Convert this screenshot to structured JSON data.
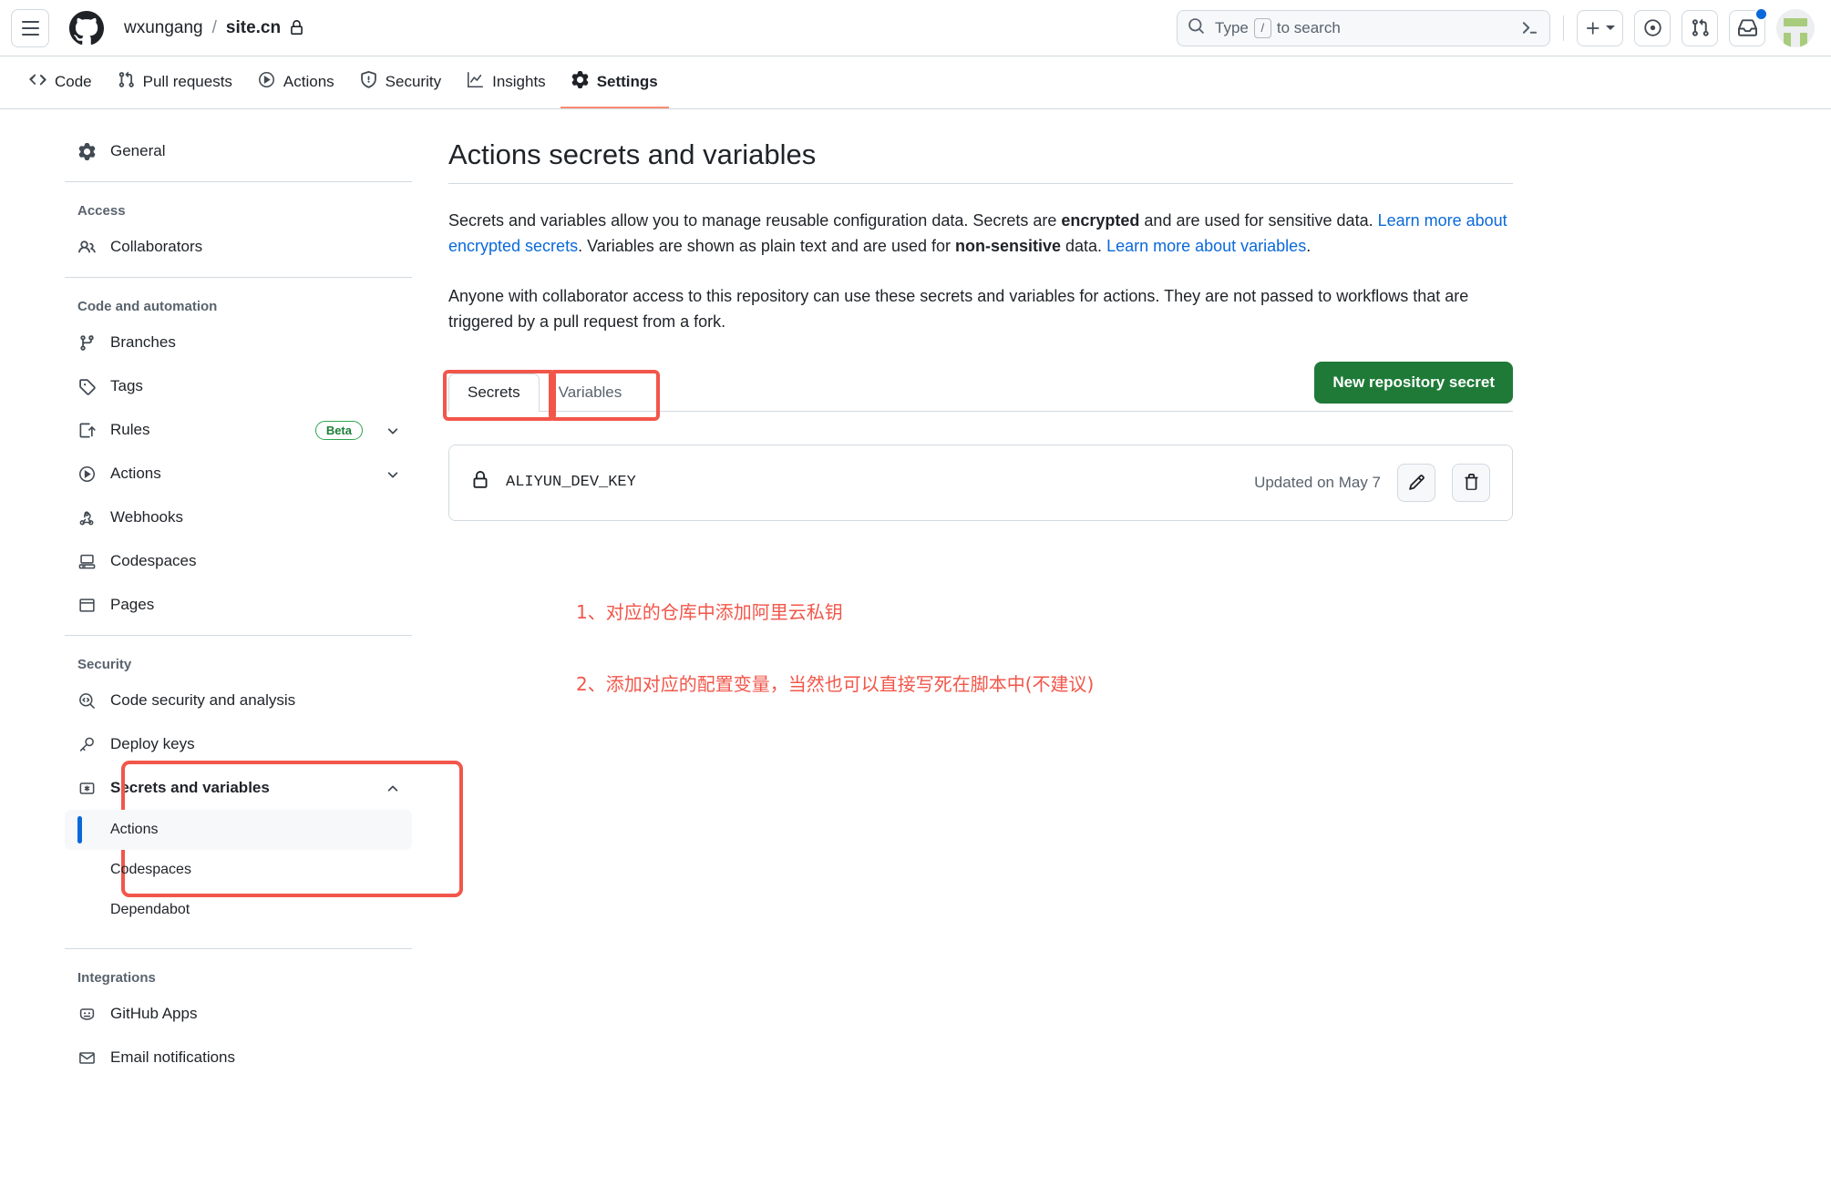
{
  "header": {
    "menu_icon": "hamburger-icon",
    "logo_icon": "github-logo-icon",
    "owner": "wxungang",
    "separator": "/",
    "repo": "site.cn",
    "private_lock_icon": "lock-icon",
    "search": {
      "icon": "search-icon",
      "placeholder_prefix": "Type",
      "slash_key": "/",
      "placeholder_suffix": "to search",
      "terminal_icon": "terminal-icon"
    },
    "create_new_label": "+",
    "issues_icon": "issue-opened-icon",
    "pull_requests_icon": "git-pull-request-icon",
    "inbox_icon": "inbox-icon",
    "avatar_label": "avatar",
    "has_notification": true
  },
  "repo_nav": [
    {
      "label": "Code",
      "icon": "code-icon",
      "active": false
    },
    {
      "label": "Pull requests",
      "icon": "git-pull-request-icon",
      "active": false
    },
    {
      "label": "Actions",
      "icon": "play-icon",
      "active": false
    },
    {
      "label": "Security",
      "icon": "shield-icon",
      "active": false
    },
    {
      "label": "Insights",
      "icon": "graph-icon",
      "active": false
    },
    {
      "label": "Settings",
      "icon": "gear-icon",
      "active": true
    }
  ],
  "sidebar": {
    "general": {
      "label": "General",
      "icon": "gear-icon"
    },
    "sections": [
      {
        "heading": "Access",
        "items": [
          {
            "label": "Collaborators",
            "icon": "people-icon"
          }
        ]
      },
      {
        "heading": "Code and automation",
        "items": [
          {
            "label": "Branches",
            "icon": "git-branch-icon"
          },
          {
            "label": "Tags",
            "icon": "tag-icon"
          },
          {
            "label": "Rules",
            "icon": "rules-icon",
            "badge": "Beta",
            "chevron": "chevron-down-icon"
          },
          {
            "label": "Actions",
            "icon": "play-icon",
            "chevron": "chevron-down-icon"
          },
          {
            "label": "Webhooks",
            "icon": "webhook-icon"
          },
          {
            "label": "Codespaces",
            "icon": "codespaces-icon"
          },
          {
            "label": "Pages",
            "icon": "browser-icon"
          }
        ]
      },
      {
        "heading": "Security",
        "items": [
          {
            "label": "Code security and analysis",
            "icon": "code-scan-icon"
          },
          {
            "label": "Deploy keys",
            "icon": "key-icon"
          }
        ]
      }
    ],
    "secrets_group": {
      "label": "Secrets and variables",
      "icon": "asterisk-key-icon",
      "chevron": "chevron-up-icon",
      "children": [
        {
          "label": "Actions",
          "selected": true
        },
        {
          "label": "Codespaces",
          "selected": false
        },
        {
          "label": "Dependabot",
          "selected": false
        }
      ]
    },
    "integrations": {
      "heading": "Integrations",
      "items": [
        {
          "label": "GitHub Apps",
          "icon": "github-apps-icon"
        },
        {
          "label": "Email notifications",
          "icon": "mail-icon"
        }
      ]
    }
  },
  "main": {
    "title": "Actions secrets and variables",
    "paragraph1": {
      "part1": "Secrets and variables allow you to manage reusable configuration data. Secrets are ",
      "bold1": "encrypted",
      "part2": " and are used for sensitive data. ",
      "link1": "Learn more about encrypted secrets",
      "part3": ". Variables are shown as plain text and are used for ",
      "bold2": "non-sensitive",
      "part4": " data. ",
      "link2": "Learn more about variables",
      "part5": "."
    },
    "paragraph2": "Anyone with collaborator access to this repository can use these secrets and variables for actions. They are not passed to workflows that are triggered by a pull request from a fork.",
    "tabs": [
      {
        "label": "Secrets",
        "active": true
      },
      {
        "label": "Variables",
        "active": false
      }
    ],
    "new_secret_button": "New repository secret",
    "secrets": [
      {
        "lock_icon": "lock-icon",
        "name": "ALIYUN_DEV_KEY",
        "updated": "Updated on May 7",
        "edit_icon": "pencil-icon",
        "delete_icon": "trash-icon"
      }
    ]
  },
  "annotations": [
    "1、对应的仓库中添加阿里云私钥",
    "2、添加对应的配置变量，当然也可以直接写死在脚本中(不建议)"
  ],
  "colors": {
    "accent_blue": "#0969da",
    "green_button": "#1f7a37",
    "annotation_red": "#f2564a",
    "border": "#d1d9e0",
    "muted_text": "#59636e",
    "beta_green": "#1a7f37"
  }
}
